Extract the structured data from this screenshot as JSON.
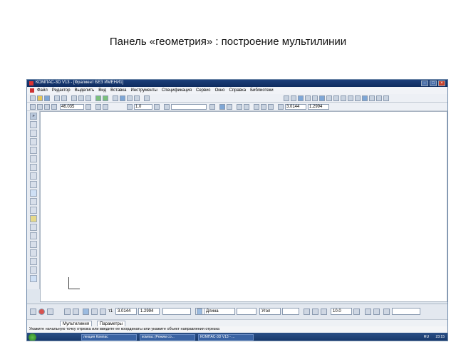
{
  "slide": {
    "title": "Панель «геометрия» : построение мультилинии"
  },
  "window": {
    "title": "КОМПАС-3D V13 - [Фрагмент БЕЗ ИМЕНИ1]",
    "controls": [
      "–",
      "□",
      "×"
    ]
  },
  "menu": [
    "Файл",
    "Редактор",
    "Выделить",
    "Вид",
    "Вставка",
    "Инструменты",
    "Спецификация",
    "Сервис",
    "Окно",
    "Справка",
    "Библиотеки"
  ],
  "toolbar": {
    "zoom_value": "46.035",
    "line_scale": "1.0",
    "coord_x": "3.0144",
    "coord_y": "1.2994"
  },
  "props": {
    "x": "3.0144",
    "y": "1.2994",
    "length_label": "Длина",
    "angle_label": "Угол",
    "angle_value": "10.0"
  },
  "tabs": [
    "Мультилиния",
    "Параметры"
  ],
  "status": {
    "text": "Укажите начальную точку отрезка или введите ее координаты или укажите объект направления отрезка"
  },
  "taskbar": {
    "items": [
      "лекция Компас",
      "компас (Режим со...",
      "КОМПАС-3D V13 - ..."
    ],
    "lang": "RU",
    "time": "23:15"
  },
  "colors": {
    "accent": "#1c3f7a",
    "canvas": "#ffffff",
    "panel": "#e3e8ef"
  }
}
